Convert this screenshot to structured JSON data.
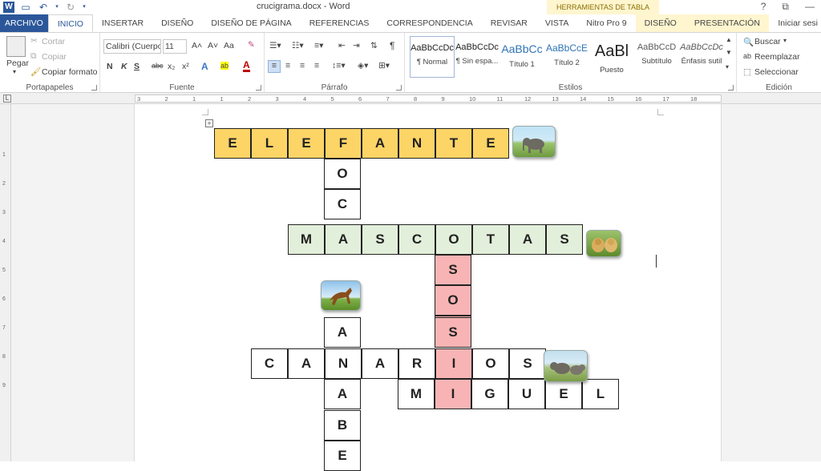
{
  "window": {
    "title": "crucigrama.docx - Word",
    "tools_header": "HERRAMIENTAS DE TABLA",
    "help": "?",
    "restore": "⧉",
    "minimize": "—",
    "close": "✕"
  },
  "qat": {
    "app_icon": "W",
    "save_icon": "save-icon",
    "undo_icon": "undo-icon",
    "redo_icon": "redo-icon"
  },
  "tabs": {
    "file": "ARCHIVO",
    "home": "INICIO",
    "insert": "INSERTAR",
    "design": "DISEÑO",
    "layout": "DISEÑO DE PÁGINA",
    "references": "REFERENCIAS",
    "mailings": "CORRESPONDENCIA",
    "review": "REVISAR",
    "view": "VISTA",
    "nitro": "Nitro Pro 9",
    "table_design": "DISEÑO",
    "table_layout": "PRESENTACIÓN",
    "signin": "Iniciar sesi"
  },
  "clipboard": {
    "paste": "Pegar",
    "cut": "Cortar",
    "copy": "Copiar",
    "format_painter": "Copiar formato",
    "label": "Portapapeles"
  },
  "font": {
    "family": "Calibri (Cuerpo",
    "size": "11",
    "grow": "A˄",
    "shrink": "A˅",
    "case": "Aa",
    "clear": "✎",
    "bold": "N",
    "italic": "K",
    "underline": "S",
    "strike": "abc",
    "subscript": "x₂",
    "superscript": "x²",
    "effects": "A",
    "highlight": "ab",
    "color": "A",
    "label": "Fuente"
  },
  "paragraph": {
    "label": "Párrafo",
    "show_marks": "¶"
  },
  "styles": {
    "label": "Estilos",
    "items": [
      {
        "sample": "AaBbCcDc",
        "name": "¶ Normal"
      },
      {
        "sample": "AaBbCcDc",
        "name": "¶ Sin espa..."
      },
      {
        "sample": "AaBbCc",
        "name": "Título 1"
      },
      {
        "sample": "AaBbCcE",
        "name": "Título 2"
      },
      {
        "sample": "AaBl",
        "name": "Puesto"
      },
      {
        "sample": "AaBbCcD",
        "name": "Subtítulo"
      },
      {
        "sample": "AaBbCcDc",
        "name": "Énfasis sutil"
      }
    ]
  },
  "editing": {
    "label": "Edición",
    "find": "Buscar",
    "replace": "Reemplazar",
    "select": "Seleccionar"
  },
  "ruler": {
    "corner": "L",
    "marks": [
      "3",
      "2",
      "1",
      "1",
      "2",
      "3",
      "4",
      "5",
      "6",
      "7",
      "8",
      "9",
      "10",
      "11",
      "12",
      "13",
      "14",
      "15",
      "16",
      "17",
      "18"
    ],
    "vmarks": [
      "1",
      "2",
      "3",
      "4",
      "5",
      "6",
      "7",
      "8",
      "9"
    ]
  },
  "crossword": {
    "table_handle": "+",
    "words": [
      {
        "name": "elefante",
        "letters": [
          "E",
          "L",
          "E",
          "F",
          "A",
          "N",
          "T",
          "E"
        ]
      },
      {
        "name": "mascotas",
        "letters": [
          "M",
          "A",
          "S",
          "C",
          "O",
          "T",
          "A",
          "S"
        ]
      },
      {
        "name": "canarios",
        "letters": [
          "C",
          "A",
          "N",
          "A",
          "R",
          "I",
          "O",
          "S"
        ]
      },
      {
        "name": "miguel",
        "letters": [
          "M",
          "I",
          "G",
          "U",
          "E",
          "L"
        ]
      },
      {
        "name": "col-f",
        "letters": [
          "O",
          "C"
        ]
      },
      {
        "name": "col-osos",
        "letters": [
          "S",
          "O",
          "S"
        ]
      },
      {
        "name": "col-a",
        "letters": [
          "A",
          "A",
          "B",
          "E"
        ]
      }
    ]
  }
}
